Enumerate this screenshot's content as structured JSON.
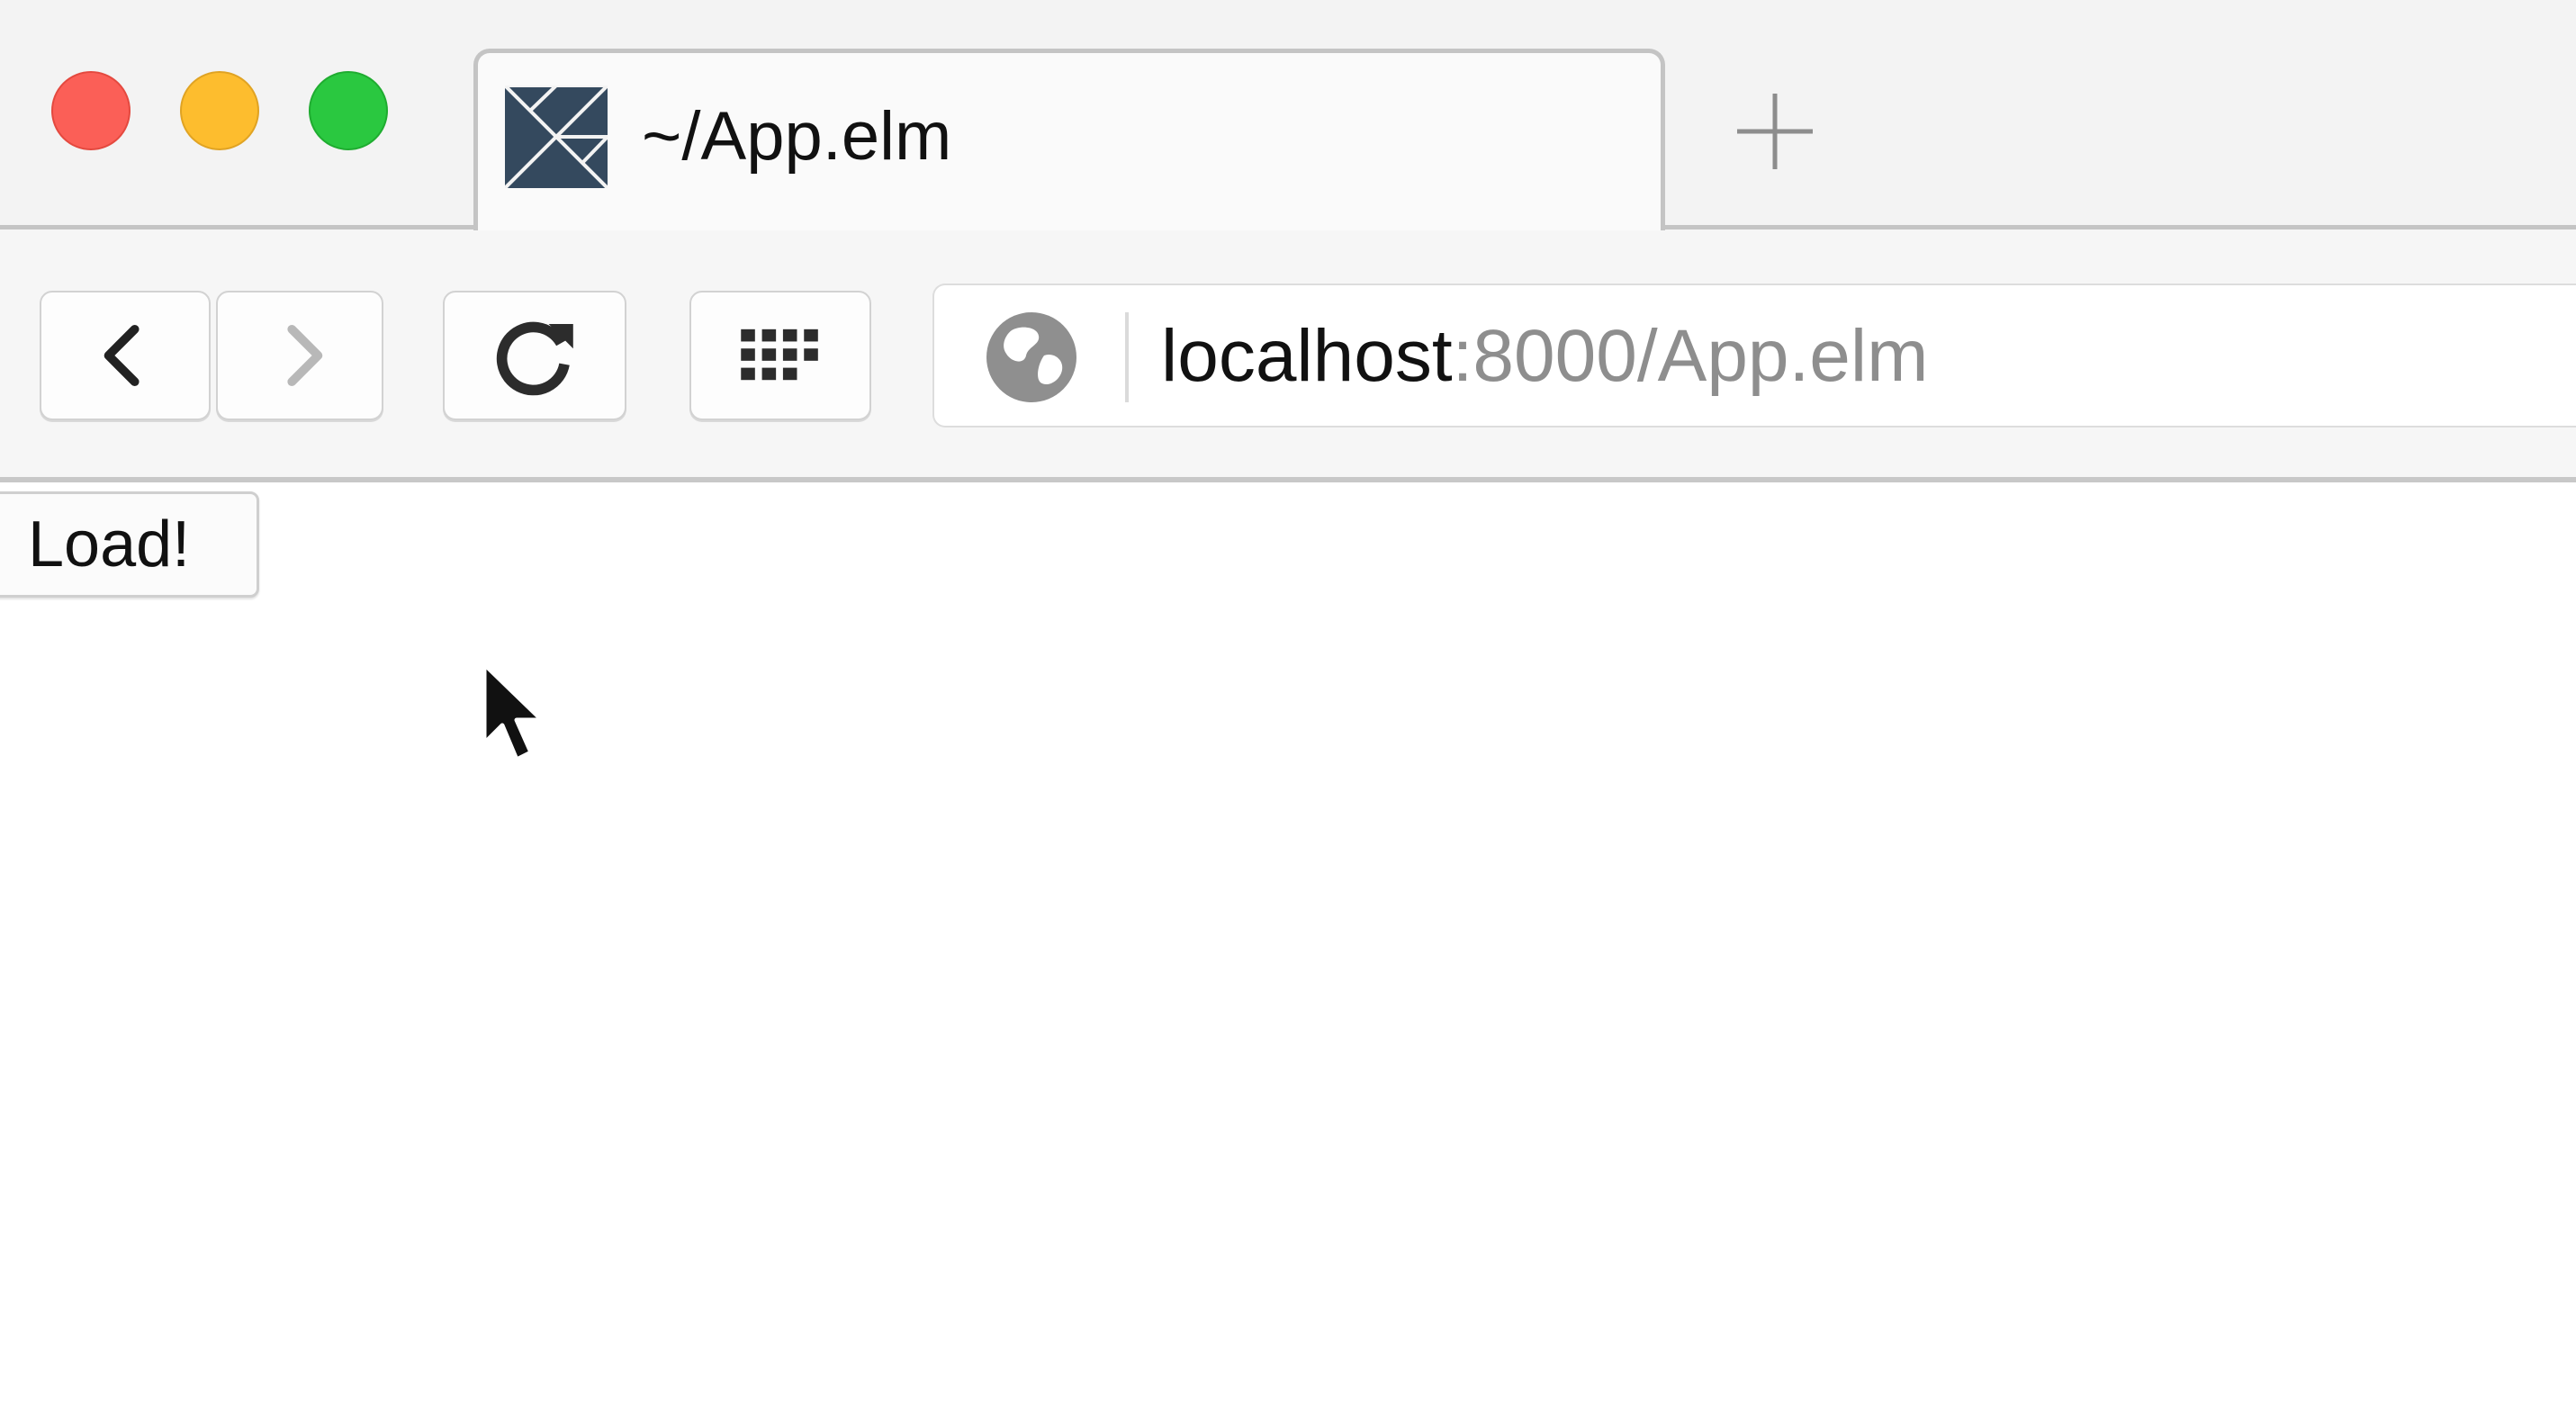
{
  "browser": {
    "tab": {
      "title": "~/App.elm",
      "favicon": "elm-tangram-icon"
    },
    "new_tab_icon": "plus-icon",
    "toolbar": {
      "back_icon": "chevron-left-icon",
      "forward_icon": "chevron-right-icon",
      "reload_icon": "reload-icon",
      "grid_icon": "grid-icon"
    },
    "address": {
      "host": "localhost",
      "rest": ":8000/App.elm",
      "site_icon": "globe-icon"
    },
    "traffic_lights": {
      "close": "#fb5f57",
      "minimize": "#fdbd2e",
      "maximize": "#2ac840"
    }
  },
  "page": {
    "button_label": "Load!"
  },
  "cursor_icon": "arrow-cursor-icon"
}
